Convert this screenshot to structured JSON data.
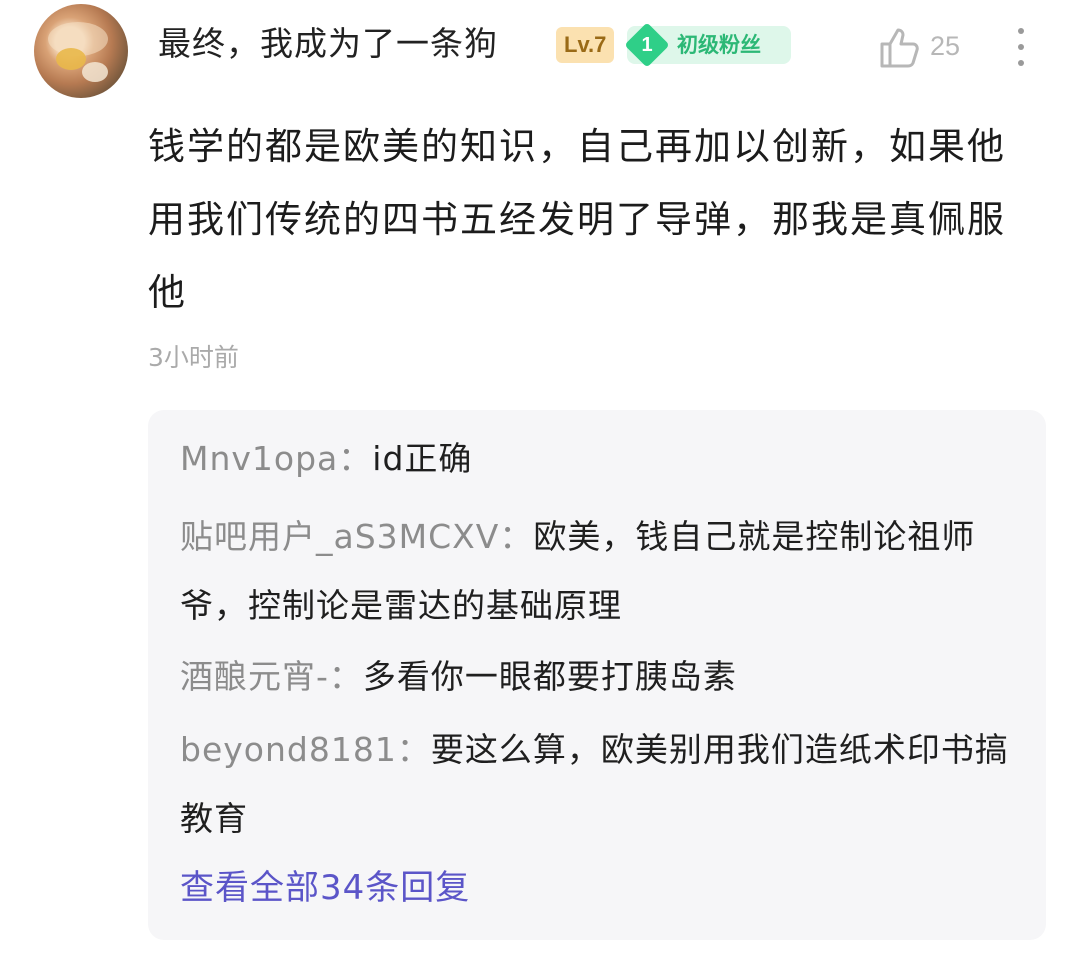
{
  "comment": {
    "username": "最终，我成为了一条狗",
    "level_badge": "Lv.7",
    "fan_level_number": "1",
    "fan_level_label": "初级粉丝",
    "like_count": "25",
    "text": "钱学的都是欧美的知识，自己再加以创新，如果他用我们传统的四书五经发明了导弹，那我是真佩服他",
    "time": "3小时前",
    "colors": {
      "fan_badge": "#2fcf88",
      "level_badge": "#fbe1b0",
      "link": "#5b55c8"
    },
    "icons": [
      "avatar",
      "thumbs-up-icon",
      "more-vertical-icon"
    ]
  },
  "replies": [
    {
      "author": "Mnv1opa：",
      "text": "id正确"
    },
    {
      "author": "贴吧用户_aS3MCXV：",
      "text": "欧美，钱自己就是控制论祖师爷，控制论是雷达的基础原理"
    },
    {
      "author": "酒酿元宵-：",
      "text": "多看你一眼都要打胰岛素"
    },
    {
      "author": "beyond8181：",
      "text": "要这么算，欧美别用我们造纸术印书搞教育"
    }
  ],
  "view_all_replies": "查看全部34条回复"
}
